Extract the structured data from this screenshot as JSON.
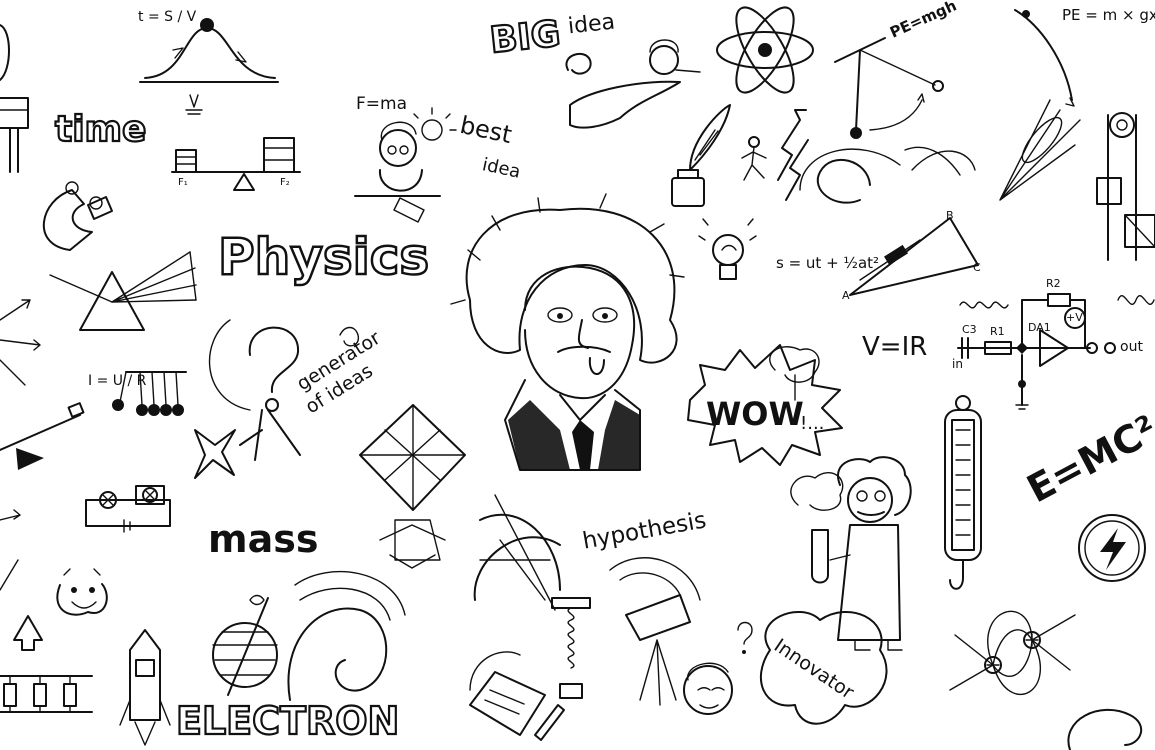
{
  "doodles": {
    "time_formula": "t = S / V",
    "word_time": "time",
    "f_ma": "F=ma",
    "best_idea_1": "best",
    "best_idea_2": "idea",
    "big_idea_1": "BIG",
    "big_idea_2": "idea",
    "pe_mgh": "PE=mgh",
    "pe_mxgx": "PE = m × gx",
    "physics": "Physics",
    "generator_1": "generator",
    "generator_2": "of ideas",
    "ohm_law": "I = U / R",
    "mass": "mass",
    "wow": "WOW",
    "hypothesis": "hypothesis",
    "innovator": "Innovator",
    "electron": "ELECTRON",
    "emc2": "E=MC²",
    "v_ir": "V=IR",
    "kinematics": "s = ut + ½at²",
    "circuit": {
      "c3": "C3",
      "r1": "R1",
      "r2": "R2",
      "da1": "DA1",
      "plus_v": "+V",
      "in": "in",
      "out": "out"
    },
    "force_f1": "F₁",
    "force_f2": "F₂",
    "abc": {
      "a": "A",
      "b": "B",
      "c": "C"
    }
  },
  "colors": {
    "ink": "#111111",
    "paper": "#ffffff"
  }
}
